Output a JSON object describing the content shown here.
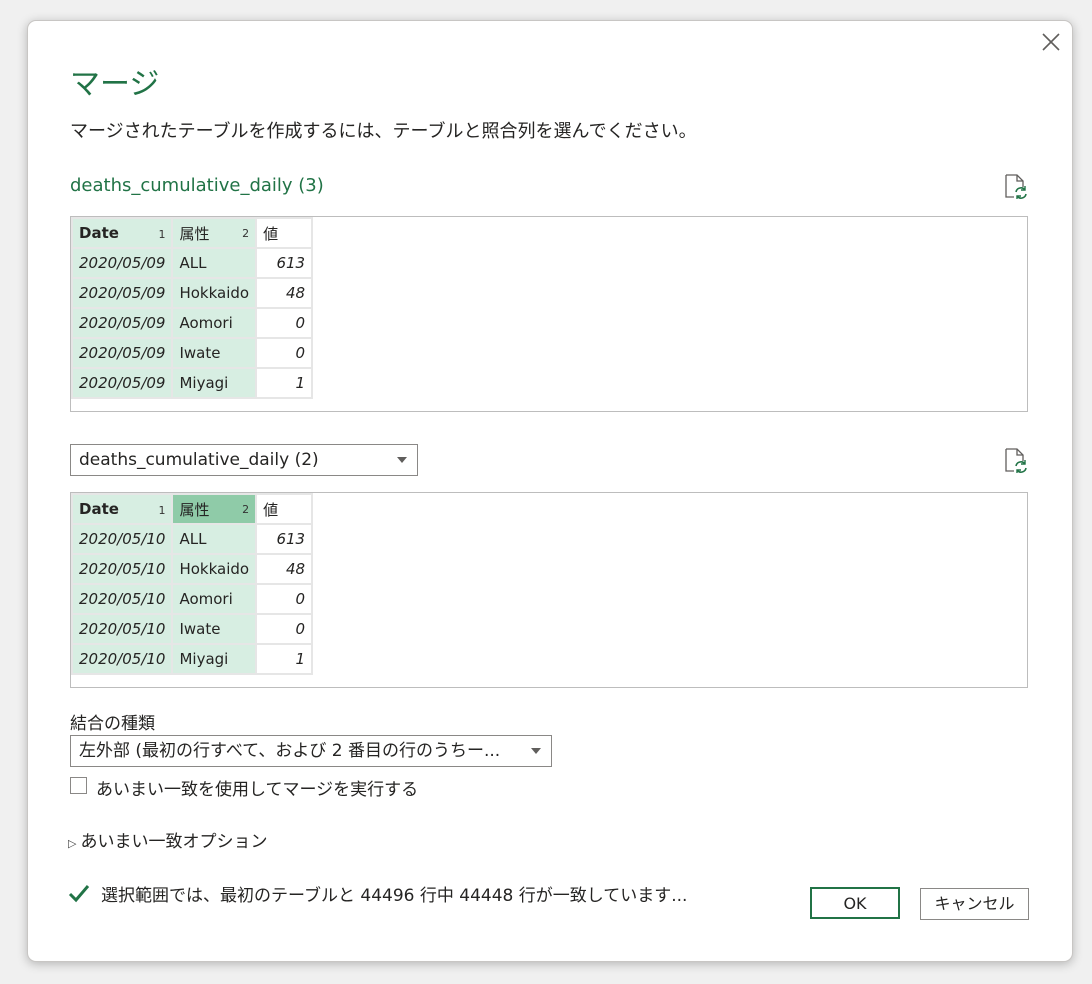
{
  "dialog": {
    "title": "マージ",
    "description": "マージされたテーブルを作成するには、テーブルと照合列を選んでください。",
    "close_icon": "close-icon",
    "refresh_icon": "refresh-file-icon"
  },
  "table1": {
    "name": "deaths_cumulative_daily (3)",
    "headers": [
      {
        "label": "Date",
        "index": "1"
      },
      {
        "label": "属性",
        "index": "2"
      },
      {
        "label": "値",
        "index": ""
      }
    ],
    "rows": [
      [
        "2020/05/09",
        "ALL",
        "613"
      ],
      [
        "2020/05/09",
        "Hokkaido",
        "48"
      ],
      [
        "2020/05/09",
        "Aomori",
        "0"
      ],
      [
        "2020/05/09",
        "Iwate",
        "0"
      ],
      [
        "2020/05/09",
        "Miyagi",
        "1"
      ]
    ]
  },
  "table2": {
    "selected": "deaths_cumulative_daily (2)",
    "headers": [
      {
        "label": "Date",
        "index": "1"
      },
      {
        "label": "属性",
        "index": "2"
      },
      {
        "label": "値",
        "index": ""
      }
    ],
    "rows": [
      [
        "2020/05/10",
        "ALL",
        "613"
      ],
      [
        "2020/05/10",
        "Hokkaido",
        "48"
      ],
      [
        "2020/05/10",
        "Aomori",
        "0"
      ],
      [
        "2020/05/10",
        "Iwate",
        "0"
      ],
      [
        "2020/05/10",
        "Miyagi",
        "1"
      ]
    ]
  },
  "join": {
    "label": "結合の種類",
    "selected": "左外部 (最初の行すべて、および 2 番目の行のうちー..."
  },
  "fuzzy": {
    "checkbox_label": "あいまい一致を使用してマージを実行する",
    "checked": false,
    "options_label": "あいまい一致オプション"
  },
  "status": {
    "text": "選択範囲では、最初のテーブルと 44496 行中 44448 行が一致しています...",
    "icon": "checkmark-icon",
    "color": "#217346"
  },
  "buttons": {
    "ok": "OK",
    "cancel": "キャンセル"
  },
  "colors": {
    "accent": "#217346",
    "selected_column": "#d7eee2",
    "selected_column_active": "#8fcba8"
  }
}
